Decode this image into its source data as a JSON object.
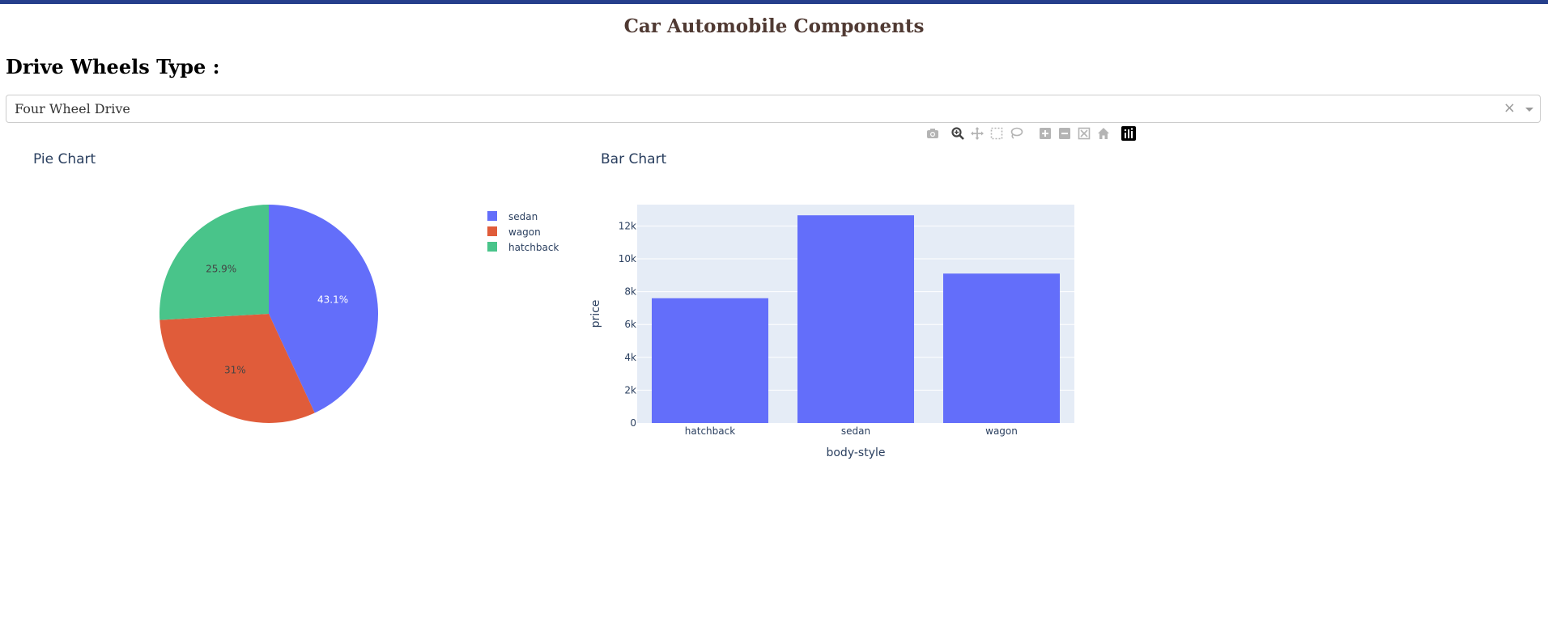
{
  "header": {
    "title": "Car Automobile Components",
    "section_label": "Drive Wheels Type :"
  },
  "dropdown": {
    "selected": "Four Wheel Drive",
    "clear_glyph": "×"
  },
  "modebar": {
    "icons": [
      "camera-icon",
      "zoom-icon",
      "pan-icon",
      "box-select-icon",
      "lasso-select-icon",
      "zoom-in-icon",
      "zoom-out-icon",
      "autoscale-icon",
      "reset-axes-icon",
      "plotly-logo-icon"
    ]
  },
  "colors": {
    "accent": "#263f8c",
    "title": "#503a33",
    "sedan": "#636efa",
    "wagon": "#e05c3a",
    "hatchback": "#49c48a",
    "plot_bg": "#e5ecf6",
    "axis_text": "#2a3f5f"
  },
  "chart_data": [
    {
      "type": "pie",
      "title": "Pie Chart",
      "labels": [
        "sedan",
        "wagon",
        "hatchback"
      ],
      "values": [
        43.1,
        31.0,
        25.9
      ],
      "text_labels": [
        "43.1%",
        "31%",
        "25.9%"
      ],
      "legend": [
        "sedan",
        "wagon",
        "hatchback"
      ],
      "legend_placement": "right"
    },
    {
      "type": "bar",
      "title": "Bar Chart",
      "categories": [
        "hatchback",
        "sedan",
        "wagon"
      ],
      "values": [
        7600,
        12650,
        9100
      ],
      "xlabel": "body-style",
      "ylabel": "price",
      "ylim": [
        0,
        13300
      ],
      "yticks": [
        0,
        2000,
        4000,
        6000,
        8000,
        10000,
        12000
      ],
      "ytick_labels": [
        "0",
        "2k",
        "4k",
        "6k",
        "8k",
        "10k",
        "12k"
      ],
      "grid": true
    }
  ]
}
